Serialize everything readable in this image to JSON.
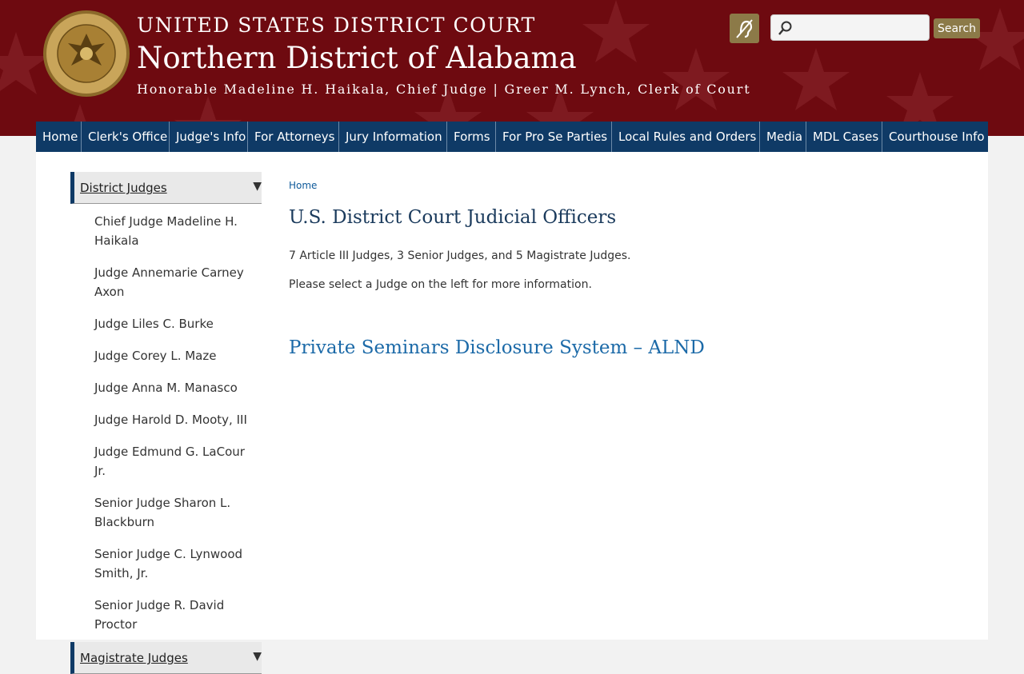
{
  "header": {
    "court_name": "UNITED STATES DISTRICT COURT",
    "district_name": "Northern District of Alabama",
    "officials_line": "Honorable Madeline H. Haikala, Chief Judge | Greer M. Lynch, Clerk of Court",
    "seal_icon": "court-seal-icon",
    "accessibility_icon": "hearing-assist-icon",
    "search": {
      "placeholder": "",
      "value": "",
      "button_label": "Search",
      "icon": "search-icon"
    },
    "colors": {
      "banner": "#6e0a10",
      "gold": "#8c7a48"
    }
  },
  "nav": {
    "items": [
      {
        "label": "Home"
      },
      {
        "label": "Clerk's Office"
      },
      {
        "label": "Judge's Info"
      },
      {
        "label": "For Attorneys"
      },
      {
        "label": "Jury Information"
      },
      {
        "label": "Forms"
      },
      {
        "label": "For Pro Se Parties"
      },
      {
        "label": "Local Rules and Orders"
      },
      {
        "label": "Media"
      },
      {
        "label": "MDL Cases"
      },
      {
        "label": "Courthouse Info"
      }
    ],
    "color": "#0f3a66"
  },
  "sidebar": {
    "section1_label": "District Judges",
    "section1_arrow": "▼",
    "judges": [
      "Chief Judge Madeline H. Haikala",
      "Judge Annemarie Carney Axon",
      "Judge Liles C. Burke",
      "Judge Corey L. Maze",
      "Judge Anna M. Manasco",
      "Judge Harold D. Mooty, III",
      "Judge Edmund G. LaCour Jr.",
      "Senior Judge Sharon L. Blackburn",
      "Senior Judge C. Lynwood Smith, Jr.",
      "Senior Judge R. David Proctor"
    ],
    "section2_label": "Magistrate Judges",
    "section2_arrow": "▼"
  },
  "main": {
    "breadcrumb": "Home",
    "title": "U.S. District Court Judicial Officers",
    "summary": "7 Article III Judges, 3 Senior Judges, and 5 Magistrate Judges.",
    "instruction": "Please select a Judge on the left for more information.",
    "link_heading": "Private Seminars Disclosure System – ALND"
  }
}
